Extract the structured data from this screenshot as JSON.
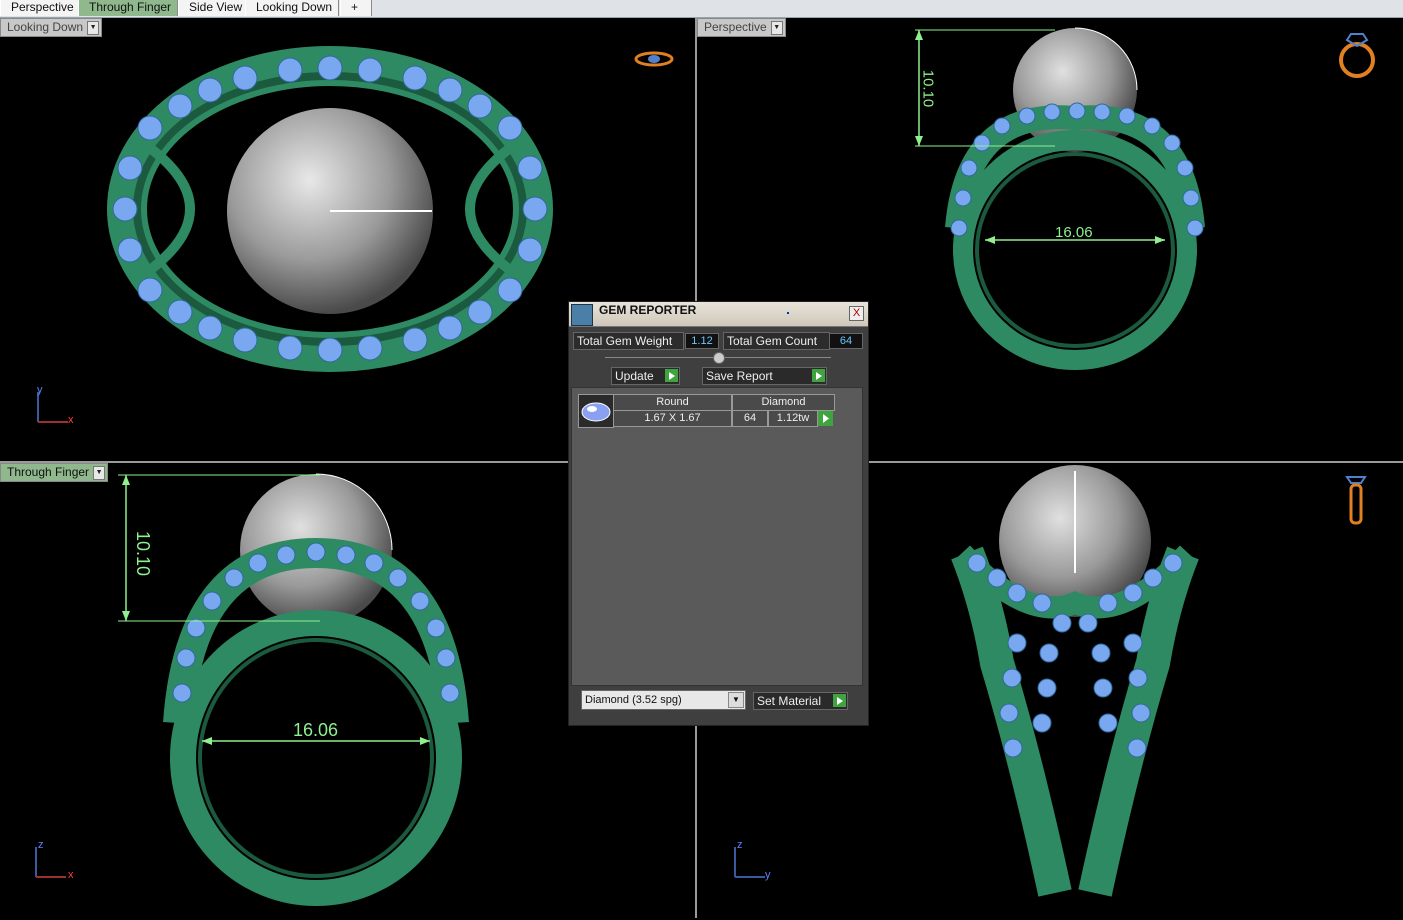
{
  "tabs": [
    "Perspective",
    "Through Finger",
    "Side View",
    "Looking Down"
  ],
  "tab_add_label": "+",
  "viewports": {
    "top_left": {
      "label": "Looking Down",
      "axis1": "y",
      "axis2": "x"
    },
    "top_right": {
      "label": "Perspective",
      "dim_height": "10.10",
      "dim_width": "16.06"
    },
    "bottom_left": {
      "label": "Through Finger",
      "dim_height": "10.10",
      "dim_width": "16.06",
      "axis1": "z",
      "axis2": "x"
    },
    "bottom_right": {
      "axis1": "z",
      "axis2": "y"
    }
  },
  "gem_reporter": {
    "title": "GEM REPORTER",
    "close": "X",
    "total_weight_label": "Total Gem Weight",
    "total_weight": "1.12",
    "total_count_label": "Total Gem Count",
    "total_count": "64",
    "update_label": "Update",
    "save_label": "Save Report",
    "row": {
      "shape": "Round",
      "material": "Diamond",
      "size": "1.67 X 1.67",
      "count": "64",
      "weight": "1.12tw"
    },
    "material_select": "Diamond    (3.52 spg)",
    "set_material_label": "Set Material"
  },
  "colors": {
    "metal": "#2e8a63",
    "metal_dark": "#1b5a3f",
    "gem": "#7aa8f0",
    "pearl": "#b8b8b8",
    "dimension": "#8ef08e",
    "active_tab": "#8fb88c"
  }
}
